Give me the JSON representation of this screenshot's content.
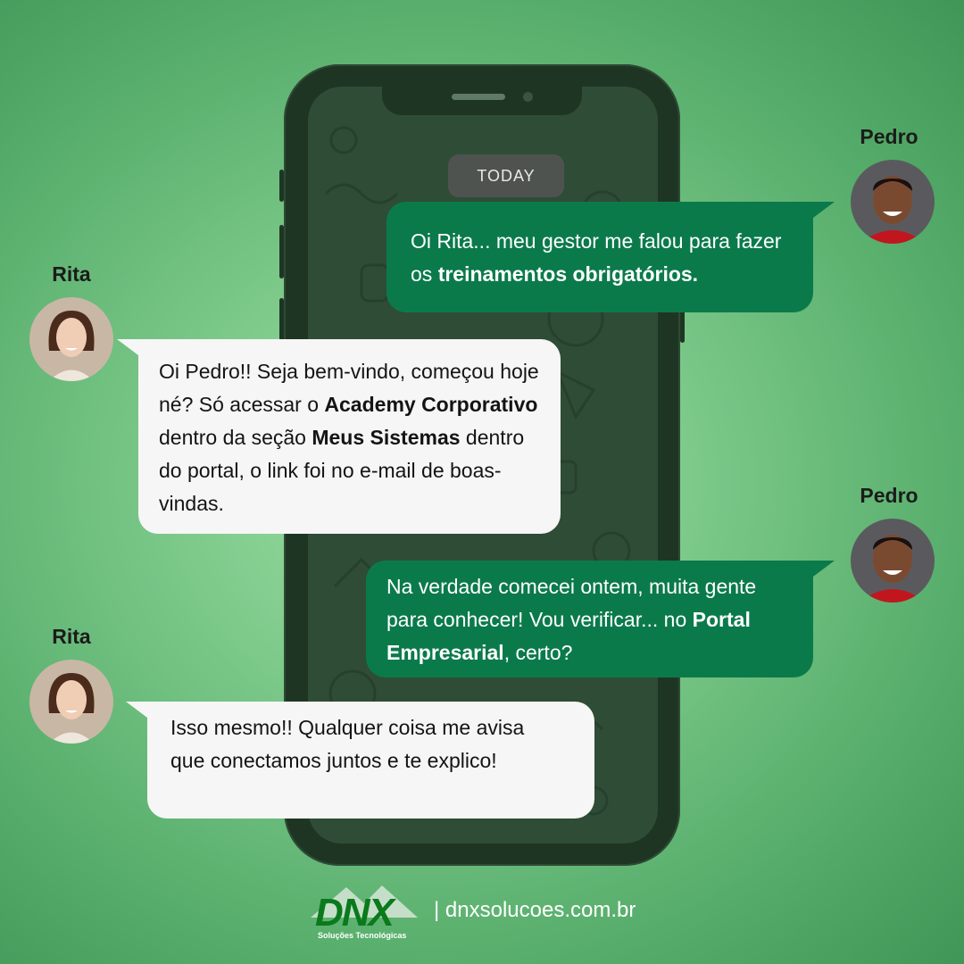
{
  "chat": {
    "date_divider": "TODAY",
    "messages": [
      {
        "sender": "Pedro",
        "direction": "outgoing",
        "segments": [
          {
            "text": "Oi Rita... meu gestor me falou para fazer os ",
            "bold": false
          },
          {
            "text": "treinamentos obrigatórios.",
            "bold": true
          }
        ]
      },
      {
        "sender": "Rita",
        "direction": "incoming",
        "segments": [
          {
            "text": "Oi Pedro!! Seja bem-vindo, começou hoje né? Só acessar o ",
            "bold": false
          },
          {
            "text": "Academy Corporativo",
            "bold": true
          },
          {
            "text": " dentro da seção ",
            "bold": false
          },
          {
            "text": "Meus Sistemas",
            "bold": true
          },
          {
            "text": " dentro do portal, o link foi no e-mail de boas-vindas.",
            "bold": false
          }
        ]
      },
      {
        "sender": "Pedro",
        "direction": "outgoing",
        "segments": [
          {
            "text": "Na verdade comecei ontem, muita gente para conhecer! Vou verificar... no ",
            "bold": false
          },
          {
            "text": "Portal Empresarial",
            "bold": true
          },
          {
            "text": ", certo?",
            "bold": false
          }
        ]
      },
      {
        "sender": "Rita",
        "direction": "incoming",
        "segments": [
          {
            "text": "Isso mesmo!! Qualquer coisa me avisa que conectamos juntos e te explico!",
            "bold": false
          }
        ]
      }
    ]
  },
  "footer": {
    "logo_text": "DNX",
    "logo_tagline": "Soluções Tecnológicas",
    "separator": "|",
    "website": "dnxsolucoes.com.br"
  },
  "colors": {
    "outgoing_bubble": "#0b7a4b",
    "incoming_bubble": "#f6f6f6",
    "phone": "#1f3524",
    "logo": "#0a7a1c"
  }
}
